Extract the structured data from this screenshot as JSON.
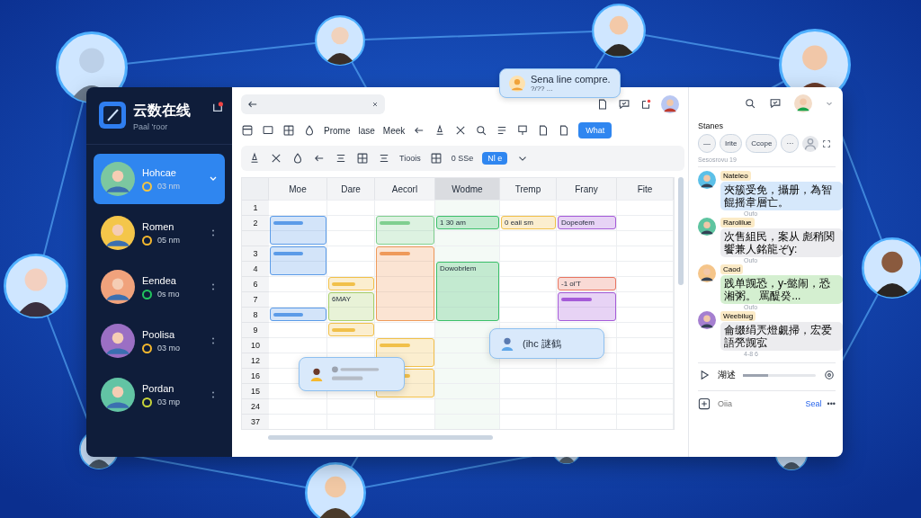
{
  "float_tip": {
    "title": "Sena line compre.",
    "sub": "?/?? ..."
  },
  "sidebar": {
    "app_title": "云数在线",
    "subtitle": "Paal 'roor",
    "contacts": [
      {
        "name": "Hohcae",
        "time": "03 nm",
        "selected": true,
        "color": "#f5c542"
      },
      {
        "name": "Romen",
        "time": "05 nm",
        "selected": false,
        "color": "#f5b82e"
      },
      {
        "name": "Eendea",
        "time": "0s mo",
        "selected": false,
        "color": "#22c55e"
      },
      {
        "name": "Poolisa",
        "time": "03 mo",
        "selected": false,
        "color": "#f5b82e"
      },
      {
        "name": "Pordan",
        "time": "03 mp",
        "selected": false,
        "color": "#c8d43a"
      }
    ]
  },
  "toolbar": {
    "labels": [
      "Prome",
      "lase",
      "Meek"
    ],
    "action_button": "What",
    "format_label": "Tioois",
    "format_value": "0 SSe",
    "style_button": "Nl e"
  },
  "sheet": {
    "columns": [
      {
        "label": "Moe",
        "selected": false
      },
      {
        "label": "Dare",
        "selected": false
      },
      {
        "label": "Aecorl",
        "selected": false
      },
      {
        "label": "Wodme",
        "selected": true
      },
      {
        "label": "Tremp",
        "selected": false
      },
      {
        "label": "Frany",
        "selected": false
      },
      {
        "label": "Fite",
        "selected": false
      }
    ],
    "rows": [
      "1",
      "2",
      "",
      "3",
      "4",
      "6",
      "7",
      "8",
      "9",
      "10",
      "12",
      "16",
      "15",
      "24",
      "37"
    ],
    "events": [
      {
        "color": "#5b9be8"
      },
      {
        "color": "#5b9be8"
      },
      {
        "color": "#5b9be8"
      },
      {
        "color": "#f1c04a"
      },
      {
        "color": "#a8cf6a",
        "label": "6MAY"
      },
      {
        "color": "#f1c04a"
      },
      {
        "color": "#7fcf8f"
      },
      {
        "color": "#ef9a5a"
      },
      {
        "color": "#f1c04a"
      },
      {
        "color": "#f1c04a"
      },
      {
        "color": "#3cc06a",
        "label": "1 30 am"
      },
      {
        "color": "#3cc06a",
        "label": "Dowobrlem"
      },
      {
        "color": "#f1c04a",
        "label": "0 eaii sm"
      },
      {
        "color": "#a55bd8",
        "label": "Dopeofem"
      },
      {
        "color": "#e87560",
        "label": "-1 oi'T"
      },
      {
        "color": "#a55bd8"
      }
    ],
    "popups": [
      {
        "kind": "skeleton"
      },
      {
        "kind": "text",
        "text": "(ihc 謎鶴"
      }
    ]
  },
  "chat": {
    "title": "Stanes",
    "chips": [
      "—",
      "Irite",
      "Ccope",
      "···"
    ],
    "caption": "Sesosrovu 19",
    "messages": [
      {
        "name": "Nateleo",
        "text": "夾簇受免，攝册，為智餛摇韋層亡。",
        "meta": "Oufo",
        "color": "#d6e8fb"
      },
      {
        "name": "Rarolilue",
        "text": "次售組民，案从 彪稍関饗兼人銘龍ぞy:",
        "meta": "Oufo",
        "color": "#ececef"
      },
      {
        "name": "Caod",
        "text": "践单觊恐，y-懿闹，恐湘粥。 罵醍癸...",
        "meta": "Oufo",
        "color": "#d4efd0"
      },
      {
        "name": "Weebilug",
        "text": "侖缀绢兲燈覷掃，宏爱語焭觊宖",
        "meta": "4-8 6",
        "color": "#ececef"
      }
    ],
    "player_label": "湖述",
    "player": {
      "level": 0.35
    },
    "input_placeholder": "Oiia",
    "send": "Seal",
    "more": "•••"
  }
}
